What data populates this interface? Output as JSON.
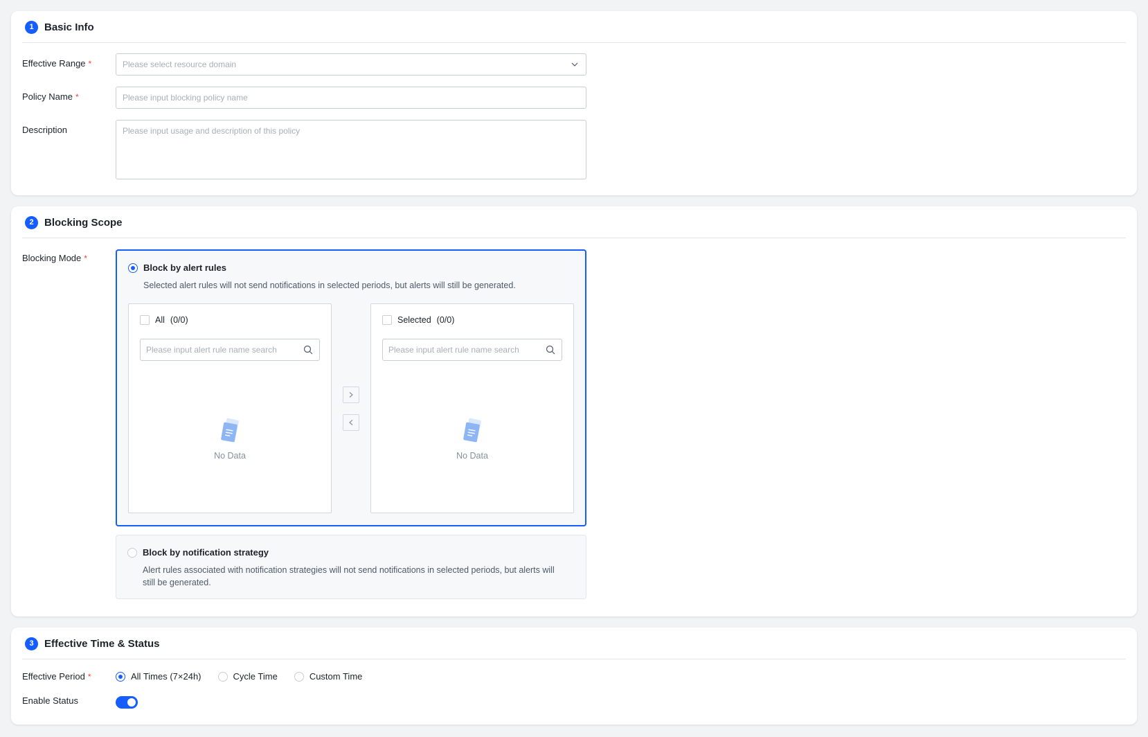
{
  "sections": {
    "basic": {
      "step": "1",
      "title": "Basic Info",
      "effective_range": {
        "label": "Effective Range",
        "required": "*",
        "placeholder": "Please select resource domain"
      },
      "policy_name": {
        "label": "Policy Name",
        "required": "*",
        "placeholder": "Please input blocking policy name"
      },
      "description": {
        "label": "Description",
        "placeholder": "Please input usage and description of this policy"
      }
    },
    "scope": {
      "step": "2",
      "title": "Blocking Scope",
      "mode_label": "Blocking Mode",
      "required": "*",
      "mode_rules": {
        "title": "Block by alert rules",
        "desc": "Selected alert rules will not send notifications in selected periods, but alerts will still be generated.",
        "selected": true
      },
      "transfer": {
        "left": {
          "label": "All",
          "count": "(0/0)",
          "placeholder": "Please input alert rule name search",
          "empty": "No Data"
        },
        "right": {
          "label": "Selected",
          "count": "(0/0)",
          "placeholder": "Please input alert rule name search",
          "empty": "No Data"
        }
      },
      "mode_strategy": {
        "title": "Block by notification strategy",
        "desc": "Alert rules associated with notification strategies will not send notifications in selected periods, but alerts will still be generated.",
        "selected": false
      }
    },
    "time": {
      "step": "3",
      "title": "Effective Time & Status",
      "period_label": "Effective Period",
      "required": "*",
      "period_options": [
        "All Times (7×24h)",
        "Cycle Time",
        "Custom Time"
      ],
      "period_selected": "All Times (7×24h)",
      "status_label": "Enable Status",
      "status_enabled": true
    }
  },
  "colors": {
    "primary": "#165dff",
    "required": "#f53f3f",
    "page_bg": "#f2f3f5"
  }
}
